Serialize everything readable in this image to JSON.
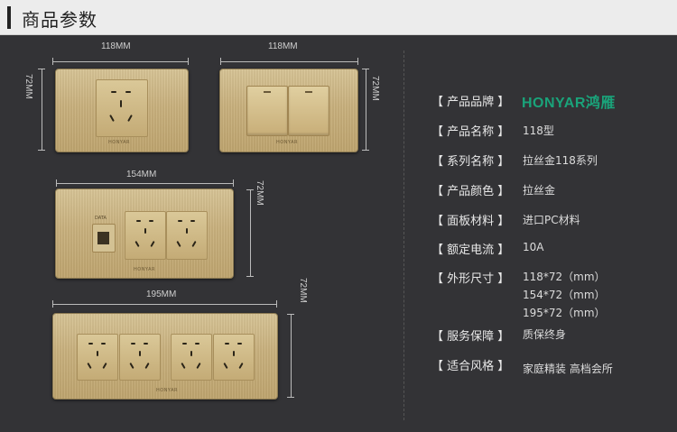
{
  "header": {
    "title": "商品参数"
  },
  "dimensions": {
    "plate1_width": "118MM",
    "plate1_height": "72MM",
    "plate2_width": "118MM",
    "plate2_height": "72MM",
    "plate3_width": "154MM",
    "plate3_height": "72MM",
    "plate4_width": "195MM",
    "plate4_height": "72MM"
  },
  "plate_text": {
    "mini_brand": "HONYAR",
    "data_label": "DATA"
  },
  "specs": {
    "brand": {
      "label": "【 产品品牌 】",
      "value": "HONYAR鸿雁"
    },
    "name": {
      "label": "【 产品名称 】",
      "value": "118型"
    },
    "series": {
      "label": "【 系列名称 】",
      "value": "拉丝金118系列"
    },
    "color": {
      "label": "【 产品颜色 】",
      "value": "拉丝金"
    },
    "material": {
      "label": "【 面板材料 】",
      "value": "进口PC材料"
    },
    "current": {
      "label": "【 额定电流 】",
      "value": "10A"
    },
    "size": {
      "label": "【 外形尺寸 】",
      "values": [
        "118*72（mm）",
        "154*72（mm）",
        "195*72（mm）"
      ]
    },
    "warranty": {
      "label": "【 服务保障 】",
      "value": "质保终身"
    },
    "style": {
      "label": "【 适合风格 】",
      "value": "家庭精装  高档会所"
    }
  },
  "colors": {
    "brand_green": "#1aa37a",
    "gold": "#c9b17e",
    "background": "#333336"
  }
}
